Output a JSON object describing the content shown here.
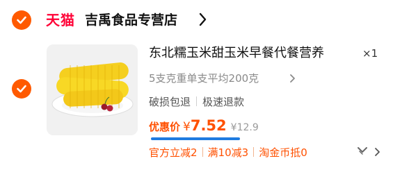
{
  "store": {
    "platform_logo": "天猫",
    "name": "吉禹食品专营店"
  },
  "item": {
    "title": "东北糯玉米甜玉米早餐代餐营养",
    "quantity": "×1",
    "spec": "5支克重单支平均200克",
    "tags": [
      "破损包退",
      "极速退款"
    ],
    "price_label": "优惠价",
    "price_currency": "¥",
    "price_value": "7.52",
    "original_price": "¥12.9",
    "promotions": [
      "官方立减2",
      "满10减3",
      "淘金币抵0"
    ]
  },
  "colors": {
    "accent": "#ff5000",
    "check": "#ff5a00",
    "tmall_red": "#ff0036",
    "highlight_underline": "#1e7be0"
  },
  "icons": {
    "store_check": "check-circle-icon",
    "item_check": "check-circle-icon",
    "store_chevron": "chevron-right-icon",
    "spec_chevron": "chevron-right-icon",
    "promo_more": "more-icon"
  }
}
